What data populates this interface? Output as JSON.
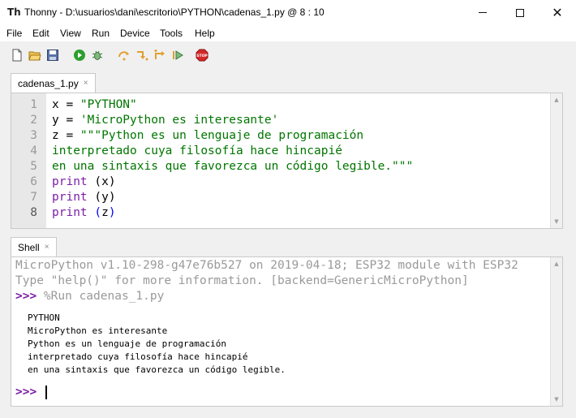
{
  "window": {
    "app_icon": "Th",
    "title": "Thonny  -  D:\\usuarios\\dani\\escritorio\\PYTHON\\cadenas_1.py  @  8 : 10",
    "controls": {
      "minimize_icon": "minimize-icon",
      "maximize_icon": "maximize-icon",
      "close_glyph": "✕"
    }
  },
  "menu": [
    "File",
    "Edit",
    "View",
    "Run",
    "Device",
    "Tools",
    "Help"
  ],
  "toolbar": {
    "icons": [
      "new-file-icon",
      "open-file-icon",
      "save-icon",
      "run-icon",
      "debug-icon",
      "step-over-icon",
      "step-into-icon",
      "step-out-icon",
      "resume-icon",
      "stop-icon"
    ],
    "stop_label": "STOP",
    "colors": {
      "run": "#2e9e2e",
      "stop": "#d42a2a",
      "step": "#e0a030"
    }
  },
  "editor": {
    "tab_label": "cadenas_1.py",
    "tab_close": "×",
    "active_line": 8,
    "lines": [
      {
        "num": "1",
        "parts": [
          {
            "t": "x = ",
            "c": "plain"
          },
          {
            "t": "\"PYTHON\"",
            "c": "str"
          }
        ]
      },
      {
        "num": "2",
        "parts": [
          {
            "t": "y = ",
            "c": "plain"
          },
          {
            "t": "'MicroPython es interesante'",
            "c": "str"
          }
        ]
      },
      {
        "num": "3",
        "parts": [
          {
            "t": "z = ",
            "c": "plain"
          },
          {
            "t": "\"\"\"Python es un lenguaje de programación",
            "c": "str"
          }
        ]
      },
      {
        "num": "4",
        "parts": [
          {
            "t": "interpretado cuya filosofía hace hincapié",
            "c": "str"
          }
        ]
      },
      {
        "num": "5",
        "parts": [
          {
            "t": "en una sintaxis que favorezca un código legible.\"\"\"",
            "c": "str"
          }
        ]
      },
      {
        "num": "6",
        "parts": [
          {
            "t": "print",
            "c": "kw"
          },
          {
            "t": " (x)",
            "c": "paren"
          }
        ]
      },
      {
        "num": "7",
        "parts": [
          {
            "t": "print",
            "c": "kw"
          },
          {
            "t": " (y)",
            "c": "paren"
          }
        ]
      },
      {
        "num": "8",
        "parts": [
          {
            "t": "print",
            "c": "kw"
          },
          {
            "t": " (",
            "c": "paren-hl"
          },
          {
            "t": "z",
            "c": "plain"
          },
          {
            "t": ")",
            "c": "paren-hl"
          }
        ]
      }
    ],
    "colors": {
      "string": "#007600",
      "keyword": "#7b1ea8",
      "bracket_match": "#0000ff"
    }
  },
  "shell": {
    "tab_label": "Shell",
    "tab_close": "×",
    "banner_1": "MicroPython v1.10-298-g47e76b527 on 2019-04-18; ESP32 module with ESP32",
    "banner_2": "Type \"help()\" for more information. [backend=GenericMicroPython]",
    "prompt": ">>>",
    "run_command": " %Run cadenas_1.py",
    "output": [
      "PYTHON",
      "MicroPython es interesante",
      "Python es un lenguaje de programación",
      "interpretado cuya filosofía hace hincapié",
      "en una sintaxis que favorezca un código legible."
    ],
    "input_value": ""
  },
  "scrollbar": {
    "up_arrow": "▲",
    "down_arrow": "▼"
  }
}
